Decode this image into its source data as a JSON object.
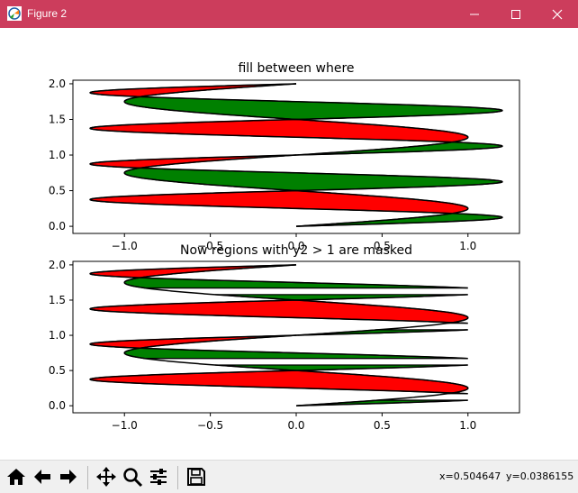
{
  "window": {
    "title": "Figure 2"
  },
  "toolbar": {
    "buttons": [
      "home-icon",
      "back-icon",
      "forward-icon",
      "pan-icon",
      "zoom-icon",
      "configure-subplots-icon",
      "save-icon"
    ],
    "coord_x": "x=0.504647",
    "coord_y": "y=0.0386155"
  },
  "colors": {
    "positive": "#008000",
    "negative": "#ff0000",
    "edge": "#000000",
    "titlebar": "#cc3d5c"
  },
  "chart_data": [
    {
      "type": "area",
      "title": "fill between where",
      "xlim": [
        -1.3,
        1.3
      ],
      "ylim": [
        -0.1,
        2.05
      ],
      "xticks": [
        -1.0,
        -0.5,
        0.0,
        0.5,
        1.0
      ],
      "xtick_labels": [
        "−1.0",
        "−0.5",
        "0.0",
        "0.5",
        "1.0"
      ],
      "yticks": [
        0.0,
        0.5,
        1.0,
        1.5,
        2.0
      ],
      "ytick_labels": [
        "0.0",
        "0.5",
        "1.0",
        "1.5",
        "2.0"
      ],
      "orientation": "horizontal fill between x1 = sin(2πy) and x2 = 1.2·sin(4πy), y from 0 to 2",
      "fill_where": [
        "x2 >= x1 → green",
        "x2 <= x1 → red"
      ],
      "masked": false
    },
    {
      "type": "area",
      "title": "Now regions with y2 > 1 are masked",
      "xlim": [
        -1.3,
        1.3
      ],
      "ylim": [
        -0.1,
        2.05
      ],
      "xticks": [
        -1.0,
        -0.5,
        0.0,
        0.5,
        1.0
      ],
      "xtick_labels": [
        "−1.0",
        "−0.5",
        "0.0",
        "0.5",
        "1.0"
      ],
      "yticks": [
        0.0,
        0.5,
        1.0,
        1.5,
        2.0
      ],
      "ytick_labels": [
        "0.0",
        "0.5",
        "1.0",
        "1.5",
        "2.0"
      ],
      "orientation": "horizontal fill between x1 = sin(2πy) and x2 = 1.2·sin(4πy), y from 0 to 2",
      "fill_where": [
        "x2 >= x1 → green",
        "x2 <= x1 → red"
      ],
      "masked": true,
      "mask_threshold": 1.0
    }
  ]
}
